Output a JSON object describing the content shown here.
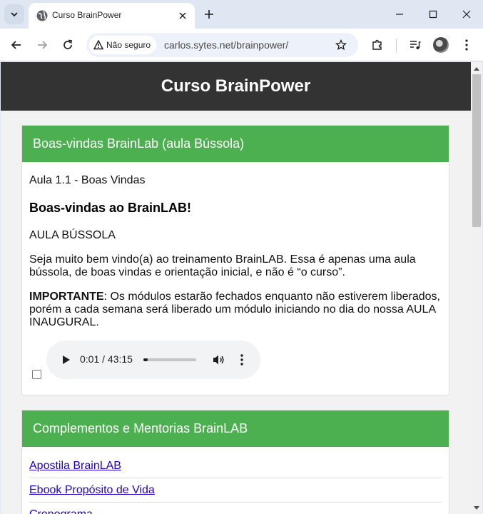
{
  "browser": {
    "tab_title": "Curso BrainPower",
    "security_label": "Não seguro",
    "url": "carlos.sytes.net/brainpower/"
  },
  "site": {
    "title": "Curso BrainPower"
  },
  "lesson_card": {
    "header": "Boas-vindas BrainLab (aula Bússola)",
    "lesson_label": "Aula 1.1 - Boas Vindas",
    "heading": "Boas-vindas ao BrainLAB!",
    "subheading": "AULA BÚSSOLA",
    "paragraph1": "Seja muito bem vindo(a) ao treinamento BrainLAB. Essa é apenas uma aula bússola, de boas vindas e orientação inicial, e não é “o curso”.",
    "important_label": "IMPORTANTE",
    "important_text": ": Os módulos estarão fechados enquanto não estiverem liberados, porém a cada semana será liberado um módulo iniciando no dia do nossa AULA INAUGURAL.",
    "audio": {
      "time": "0:01 / 43:15",
      "progress": 0.0004
    },
    "completed_checkbox": false
  },
  "complements_card": {
    "header": "Complementos e Mentorias BrainLAB",
    "links": [
      "Apostila BrainLAB",
      "Ebook Propósito de Vida",
      "Cronograma"
    ]
  }
}
